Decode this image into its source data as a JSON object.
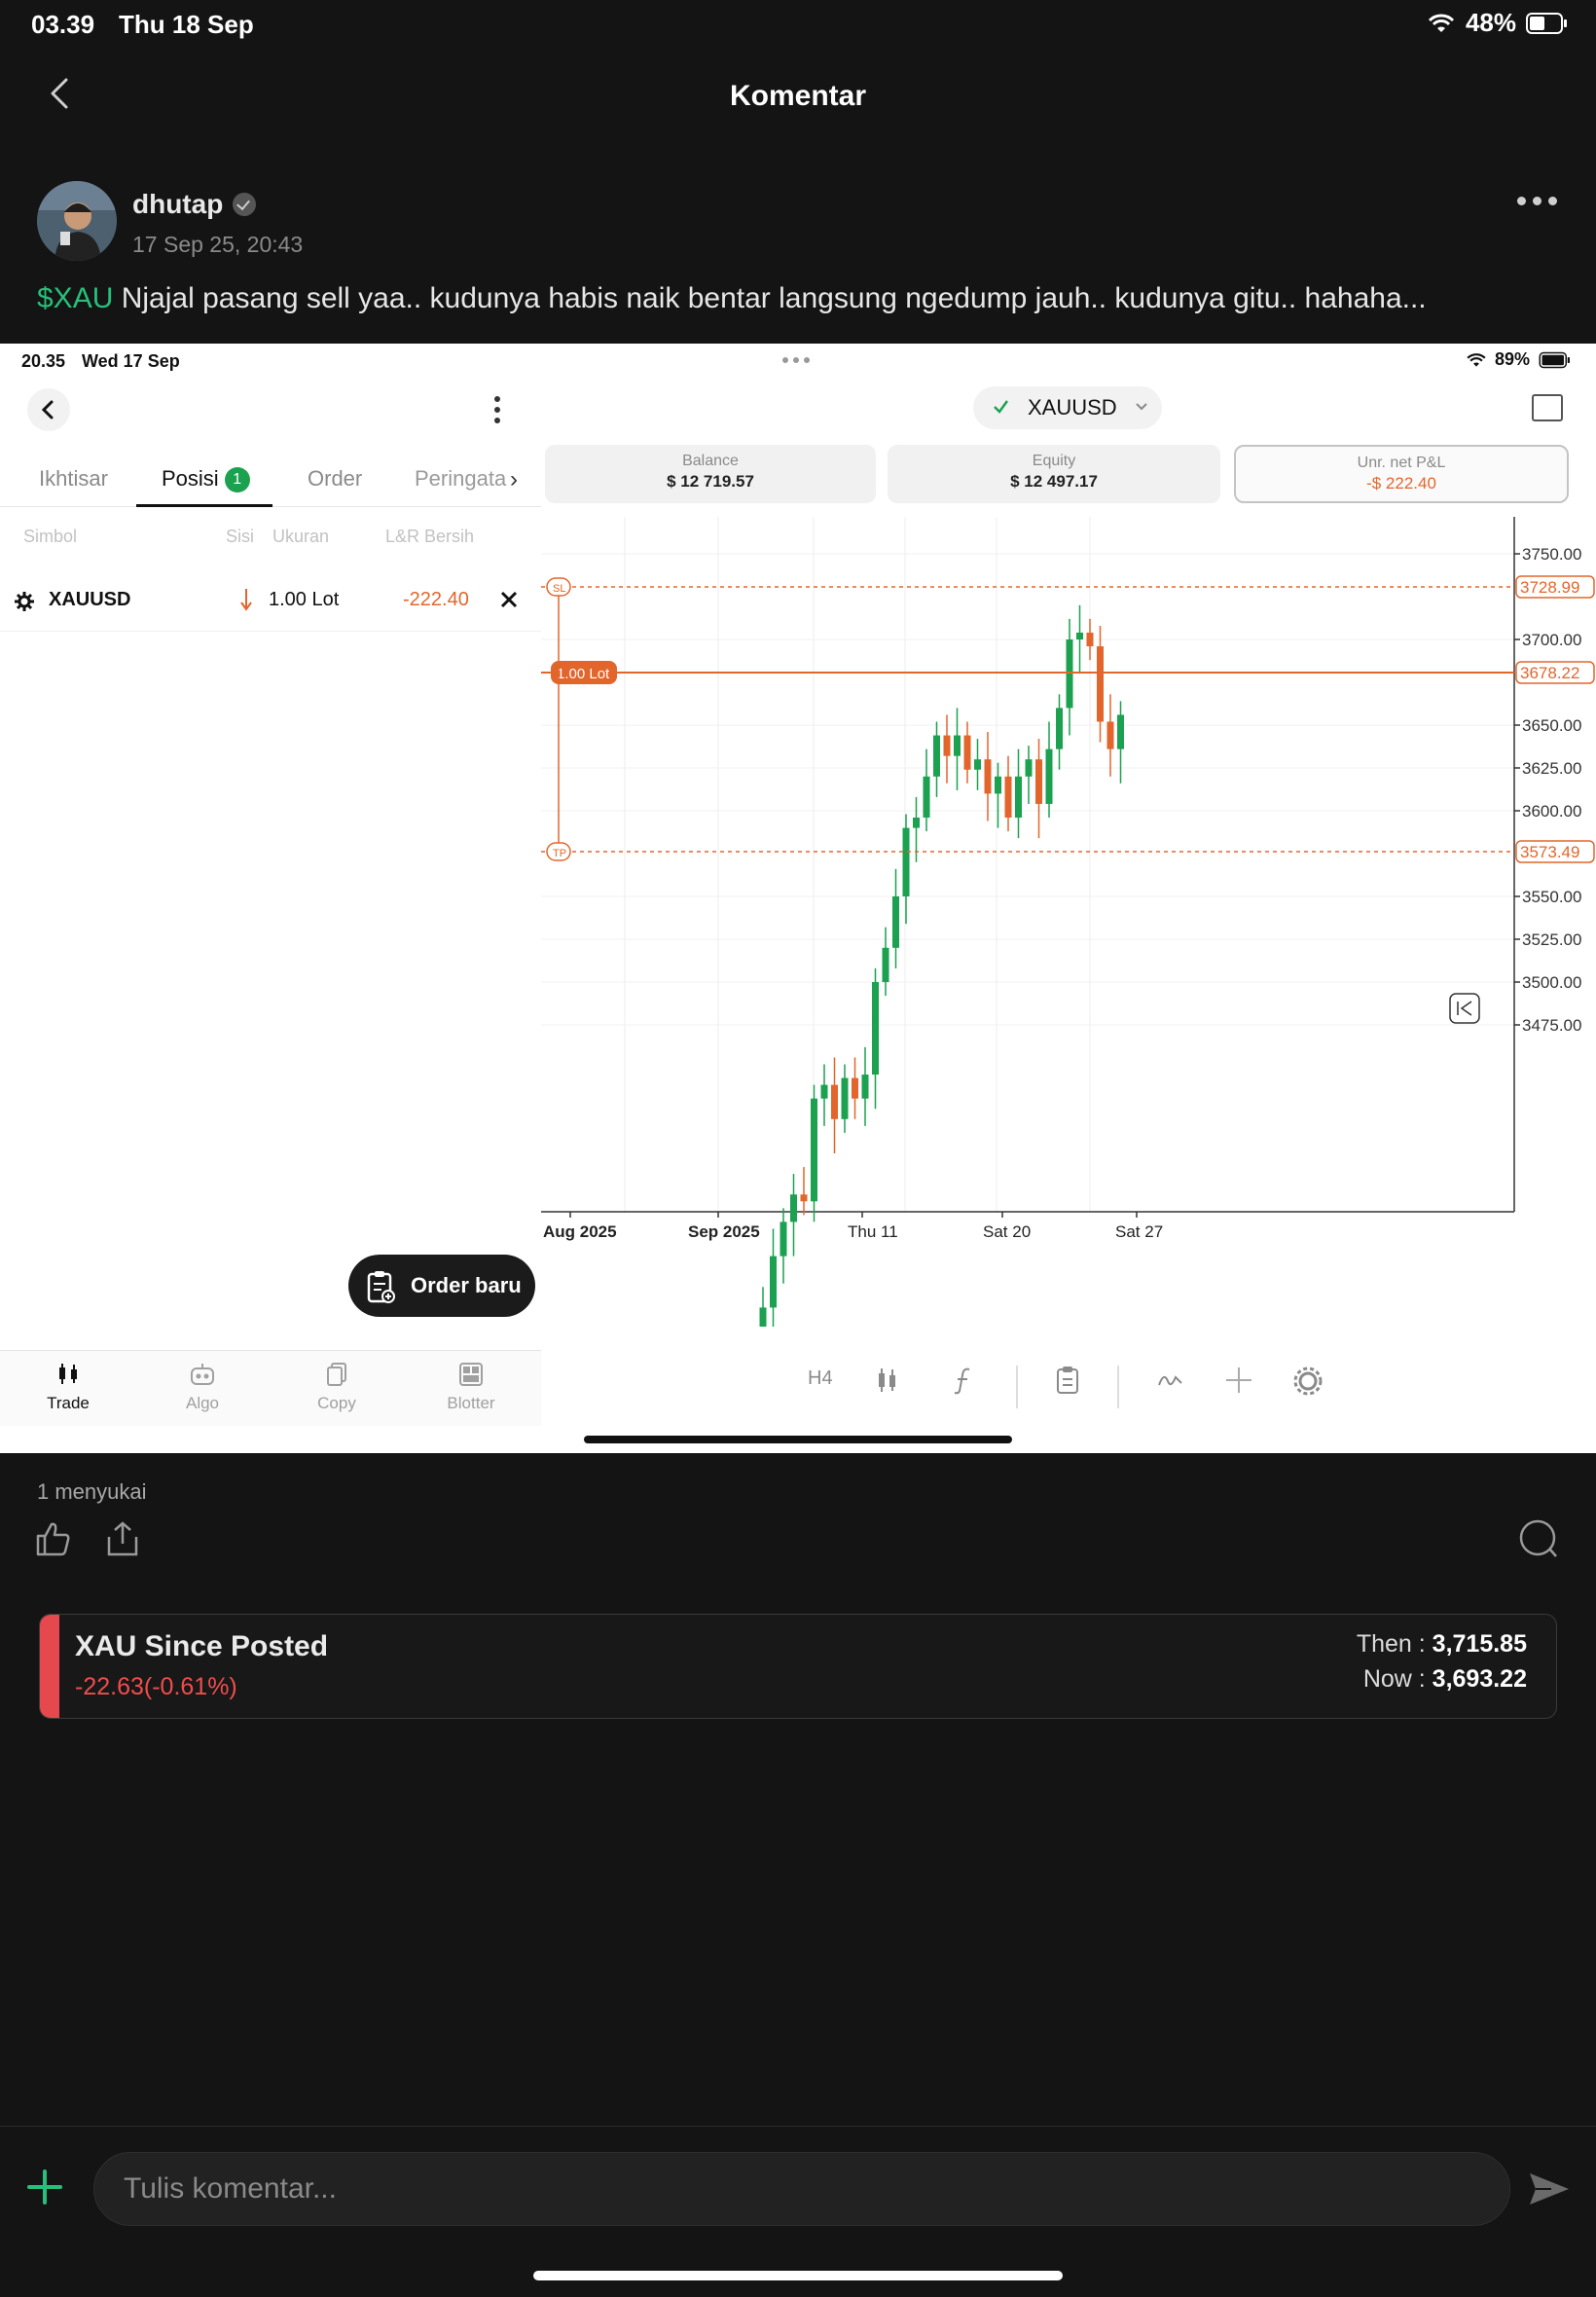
{
  "status_bar": {
    "time": "03.39",
    "date": "Thu 18 Sep",
    "battery": "48%"
  },
  "nav": {
    "title": "Komentar"
  },
  "post": {
    "username": "dhutap",
    "timestamp": "17 Sep 25, 20:43",
    "ticker": "$XAU",
    "text": " Njajal pasang sell yaa.. kudunya habis naik bentar langsung ngedump jauh.. kudunya gitu.. hahaha..."
  },
  "screenshot": {
    "status": {
      "time": "20.35",
      "date": "Wed 17 Sep",
      "battery": "89%"
    },
    "tabs": [
      {
        "label": "Ikhtisar"
      },
      {
        "label": "Posisi",
        "badge": "1"
      },
      {
        "label": "Order"
      },
      {
        "label": "Peringata"
      }
    ],
    "columns": [
      "Simbol",
      "Sisi",
      "Ukuran",
      "L&R Bersih"
    ],
    "position": {
      "symbol": "XAUUSD",
      "size": "1.00 Lot",
      "pnl": "-222.40"
    },
    "order_new": "Order baru",
    "bottom_nav": [
      "Trade",
      "Algo",
      "Copy",
      "Blotter"
    ],
    "symbol": "XAUUSD",
    "metrics": {
      "balance_label": "Balance",
      "balance": "$ 12 719.57",
      "equity_label": "Equity",
      "equity": "$ 12 497.17",
      "pnl_label": "Unr. net P&L",
      "pnl": "-$ 222.40"
    },
    "toolbar": {
      "timeframe": "H4"
    }
  },
  "chart_data": {
    "type": "candlestick",
    "y_ticks": [
      "3750.00",
      "3700.00",
      "3650.00",
      "3625.00",
      "3600.00",
      "3550.00",
      "3525.00",
      "3500.00",
      "3475.00"
    ],
    "x_ticks": [
      "Aug 2025",
      "Sep 2025",
      "Thu 11",
      "Sat 20",
      "Sat 27"
    ],
    "levels": [
      {
        "tag": "SL",
        "price": "3728.99"
      },
      {
        "tag": "1.00 Lot",
        "price": "3678.22"
      },
      {
        "tag": "TP",
        "price": "3573.49"
      }
    ]
  },
  "engagement": {
    "likes": "1 menyukai"
  },
  "since_posted": {
    "title": "XAU Since Posted",
    "change": "-22.63(-0.61%)",
    "then_label": "Then : ",
    "then_value": "3,715.85",
    "now_label": "Now : ",
    "now_value": "3,693.22"
  },
  "composer": {
    "placeholder": "Tulis komentar..."
  },
  "colors": {
    "accent": "#27c07a",
    "negative": "#e5484d",
    "chart_up": "#1ba150",
    "chart_down": "#e2662c"
  }
}
